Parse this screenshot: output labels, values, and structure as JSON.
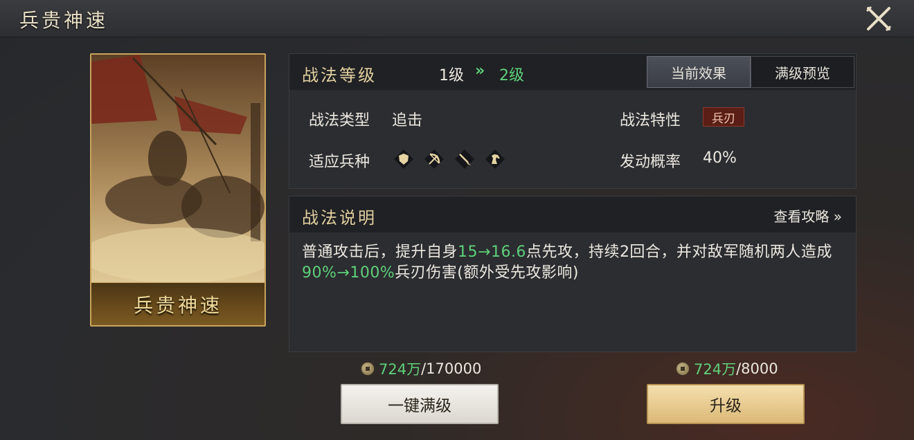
{
  "window": {
    "title": "兵贵神速"
  },
  "card": {
    "name": "兵贵神速"
  },
  "level_panel": {
    "title": "战法等级",
    "level_from": "1级",
    "arrow": "»",
    "level_to": "2级",
    "tabs": [
      {
        "label": "当前效果",
        "active": true
      },
      {
        "label": "满级预览",
        "active": false
      }
    ],
    "type_label": "战法类型",
    "type_value": "追击",
    "trait_label": "战法特性",
    "trait_value": "兵刃",
    "troop_label": "适应兵种",
    "troop_icons": [
      "shield-icon",
      "bow-icon",
      "spear-icon",
      "horse-icon"
    ],
    "chance_label": "发动概率",
    "chance_value": "40%"
  },
  "desc_panel": {
    "title": "战法说明",
    "guide_link": "查看攻略 »",
    "text_1": "普通攻击后，提升自身",
    "hl_1": "15→16.6",
    "text_2": "点先攻，持续2回合，并对敌军随机两人造成",
    "hl_2": "90%→100%",
    "text_3": "兵刃伤害(额外受先攻影响)"
  },
  "costs": {
    "max_have": "724万",
    "max_need": "/170000",
    "up_have": "724万",
    "up_need": "/8000"
  },
  "buttons": {
    "max_label": "一键满级",
    "up_label": "升级"
  },
  "colors": {
    "accent_gold": "#e2cf9f",
    "highlight_green": "#5fd07a",
    "trait_red": "#5a1e16"
  }
}
